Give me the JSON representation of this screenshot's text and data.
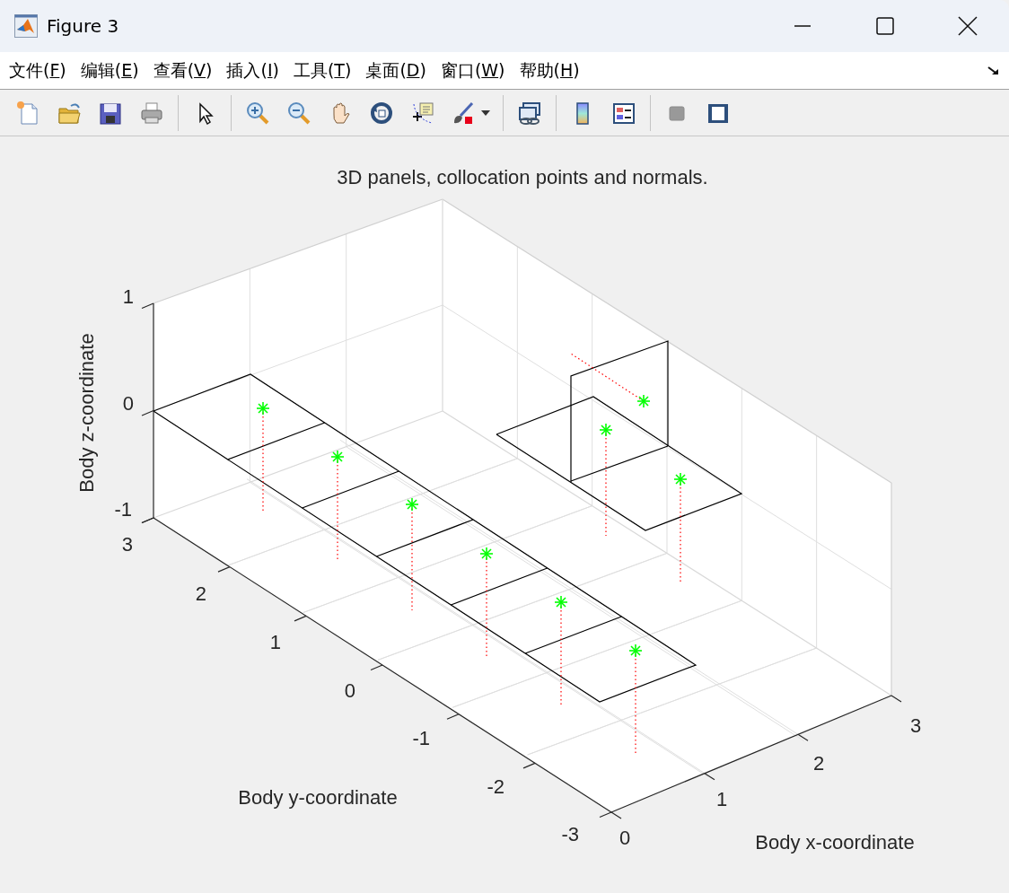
{
  "window": {
    "title": "Figure 3"
  },
  "menu": [
    {
      "label_parts": [
        "文件(",
        "F",
        ")"
      ]
    },
    {
      "label_parts": [
        "编辑(",
        "E",
        ")"
      ]
    },
    {
      "label_parts": [
        "查看(",
        "V",
        ")"
      ]
    },
    {
      "label_parts": [
        "插入(",
        "I",
        ")"
      ]
    },
    {
      "label_parts": [
        "工具(",
        "T",
        ")"
      ]
    },
    {
      "label_parts": [
        "桌面(",
        "D",
        ")"
      ]
    },
    {
      "label_parts": [
        "窗口(",
        "W",
        ")"
      ]
    },
    {
      "label_parts": [
        "帮助(",
        "H",
        ")"
      ]
    }
  ],
  "toolbar": [
    [
      {
        "kind": "new"
      },
      {
        "kind": "open"
      },
      {
        "kind": "save"
      },
      {
        "kind": "print"
      }
    ],
    [
      {
        "kind": "pointer"
      }
    ],
    [
      {
        "kind": "zoom-in"
      },
      {
        "kind": "zoom-out"
      },
      {
        "kind": "pan"
      },
      {
        "kind": "rotate"
      },
      {
        "kind": "data-tip"
      },
      {
        "kind": "brush"
      }
    ],
    [
      {
        "kind": "link"
      }
    ],
    [
      {
        "kind": "colorbar"
      },
      {
        "kind": "legend"
      }
    ],
    [
      {
        "kind": "hide-tools"
      },
      {
        "kind": "show-tools"
      }
    ]
  ],
  "axes": {
    "title": "3D panels, collocation points and normals.",
    "xlabel": "Body x-coordinate",
    "ylabel": "Body y-coordinate",
    "zlabel": "Body z-coordinate",
    "xticks": [
      "0",
      "1",
      "2",
      "3"
    ],
    "yticks": [
      "3",
      "2",
      "1",
      "0",
      "-1",
      "-2",
      "-3"
    ],
    "zticks": [
      "1",
      "0",
      "-1"
    ]
  }
}
